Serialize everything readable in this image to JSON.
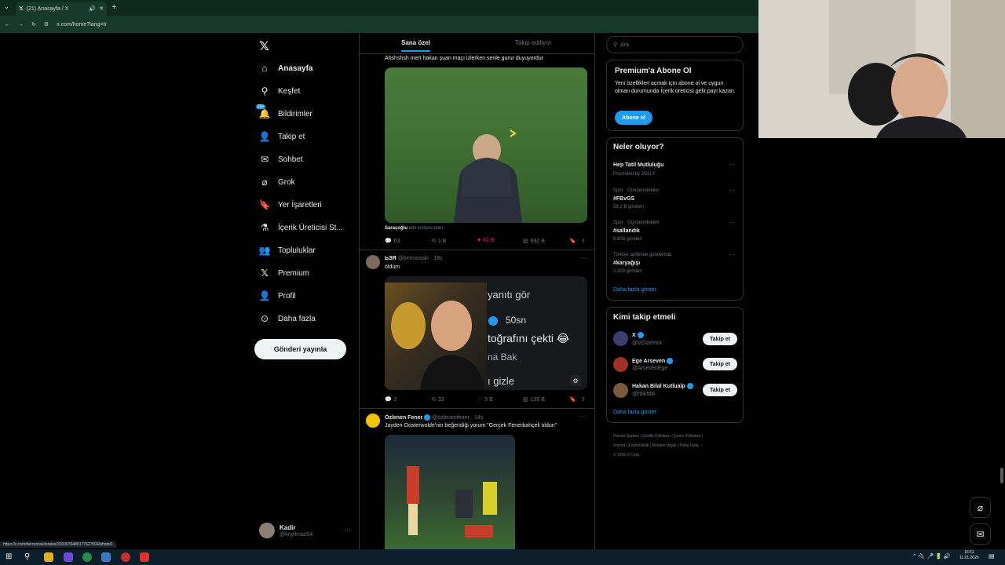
{
  "browser": {
    "tab_title": "(21) Anasayfa / X",
    "url": "x.com/home?lang=tr",
    "status_url": "https://x.com/berroosski/status/2010076480177627504/photo/1"
  },
  "nav": {
    "items": [
      {
        "label": "Anasayfa",
        "icon": "home-icon"
      },
      {
        "label": "Keşfet",
        "icon": "search-icon"
      },
      {
        "label": "Bildirimler",
        "icon": "bell-icon",
        "badge": "20+"
      },
      {
        "label": "Takip et",
        "icon": "add-person-icon"
      },
      {
        "label": "Sohbet",
        "icon": "mail-icon"
      },
      {
        "label": "Grok",
        "icon": "grok-icon"
      },
      {
        "label": "Yer İşaretleri",
        "icon": "bookmark-icon"
      },
      {
        "label": "İçerik Üreticisi St...",
        "icon": "flask-icon"
      },
      {
        "label": "Topluluklar",
        "icon": "people-icon"
      },
      {
        "label": "Premium",
        "icon": "x-logo-icon"
      },
      {
        "label": "Profil",
        "icon": "person-icon"
      },
      {
        "label": "Daha fazla",
        "icon": "more-circle-icon"
      }
    ],
    "post_button": "Gönderi yayınla",
    "account_name": "Kadir",
    "account_handle": "@knyilmaz54"
  },
  "feed": {
    "tabs": [
      "Sana özel",
      "Takip ediliyor"
    ],
    "post1": {
      "text": "Ahshshsh mert hakan şuan maçı izlerken senle gurur duyuyordur",
      "media_caption_name": "Saraçoğlu",
      "media_caption_rest": "adlı kullanıcıdan",
      "replies": "63",
      "reposts": "1 B",
      "likes": "42 B",
      "views": "692 B"
    },
    "post2": {
      "name": "ЬЭЯ",
      "handle": "@berroosski",
      "time": "18s",
      "text": "öldüm",
      "overlay": [
        "yanıtı gör",
        "50sn",
        "toğrafını çekti 😂",
        "na Bak",
        "ı gizle"
      ],
      "replies": "2",
      "reposts": "33",
      "likes": "5 B",
      "views": "136 B"
    },
    "post3": {
      "name": "Özlenen Fener",
      "handle": "@ozlenenfener",
      "time": "14s",
      "text": "Jayden Oosterwolde'nin beğendiği yorum \"Gerçek Fenerbahçeli oldun\""
    }
  },
  "right": {
    "search_placeholder": "Ara",
    "premium": {
      "title": "Premium'a Abone Ol",
      "desc": "Yeni özellikleri açmak için abone ol ve uygun olman durumunda İçerik üreticisi gelir payı kazan.",
      "button": "Abone ol"
    },
    "trends": {
      "title": "Neler oluyor?",
      "items": [
        {
          "category": "",
          "name": "Hep Tatil Mutluluğu",
          "count": "Promoted by JOLLY"
        },
        {
          "category": "Spor · Gündemdekiler",
          "name": "#FBvGS",
          "count": "58,2 B gönderi"
        },
        {
          "category": "Spor · Gündemdekiler",
          "name": "#sallandık",
          "count": "6.609 gönderi"
        },
        {
          "category": "Türkiye tarihinde gündemde",
          "name": "#karyağışı",
          "count": "2.300 gönderi"
        }
      ],
      "more": "Daha fazla göster"
    },
    "who_to_follow": {
      "title": "Kimi takip etmeli",
      "items": [
        {
          "name": "X",
          "handle": "@VGizemnr",
          "button": "Takip et"
        },
        {
          "name": "Ege Arseven",
          "handle": "@ArsevenEge",
          "button": "Takip et"
        },
        {
          "name": "Hakan Bilal Kutlualp",
          "handle": "@hbkhbk",
          "button": "Takip et"
        }
      ],
      "more": "Daha fazla göster"
    },
    "footer": {
      "line1": [
        "Hizmet Şartları",
        "Gizlilik Politikası",
        "Çerez Politikası"
      ],
      "line2": [
        "Imprint",
        "Erişilebilirlik",
        "Reklam bilgisi",
        "Daha fazla ···"
      ],
      "copyright": "© 2026 X Corp."
    }
  },
  "taskbar": {
    "time": "16:51",
    "date": "11.01.2026"
  },
  "colors": {
    "accent": "#1d9bf0",
    "like": "#f91880",
    "chrome": "#16392a"
  }
}
